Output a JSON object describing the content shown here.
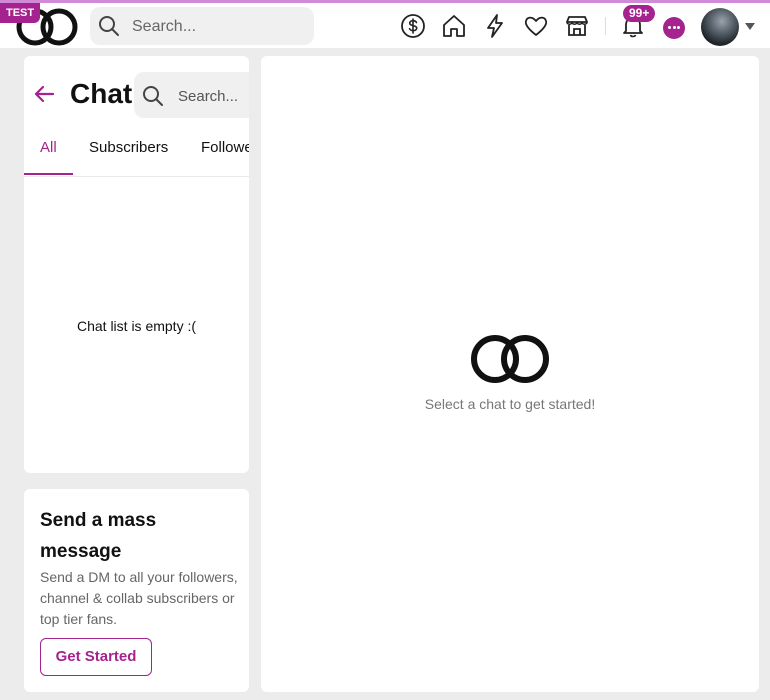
{
  "header": {
    "env_badge": "TEST",
    "search_placeholder": "Search...",
    "notifications_count": "99+",
    "nav_icons": [
      "dollar-icon",
      "home-icon",
      "lightning-icon",
      "heart-icon",
      "store-icon",
      "bell-icon",
      "chat-icon"
    ]
  },
  "chat_panel": {
    "title": "Chat",
    "search_placeholder": "Search...",
    "tabs": [
      {
        "label": "All",
        "active": true
      },
      {
        "label": "Subscribers",
        "active": false
      },
      {
        "label": "Followers",
        "active": false
      }
    ],
    "empty_message": "Chat list is empty :("
  },
  "mass_message": {
    "title": "Send a mass message",
    "description": "Send a DM to all your followers, channel & collab subscribers or top tier fans.",
    "button_label": "Get Started"
  },
  "main": {
    "prompt": "Select a chat to get started!"
  },
  "colors": {
    "accent": "#a4238f",
    "page_bg": "#ececec"
  }
}
